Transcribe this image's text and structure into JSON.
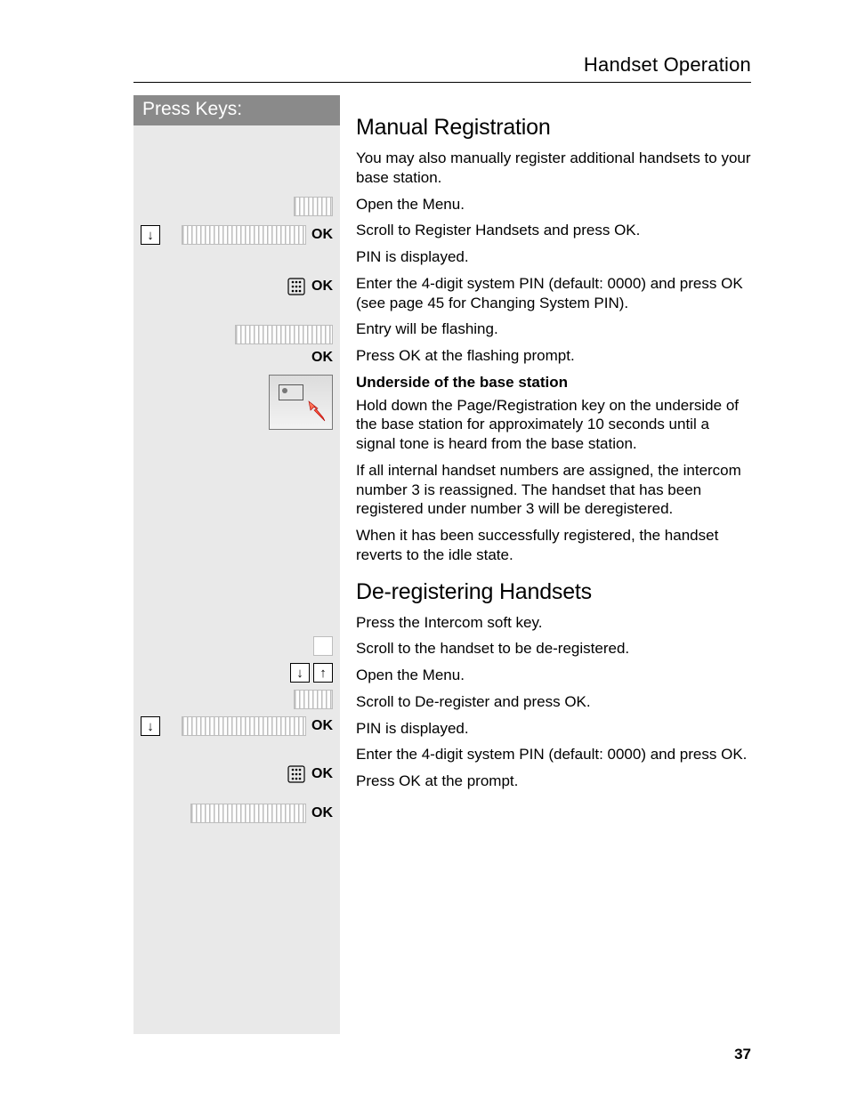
{
  "header": {
    "section_title": "Handset Operation"
  },
  "left": {
    "press_keys_label": "Press Keys:"
  },
  "ok_label": "OK",
  "content": {
    "h_manual": "Manual Registration",
    "p_intro": "You may also manually register additional handsets to your base station.",
    "p_open_menu": "Open the Menu.",
    "p_scroll_reg": "Scroll to Register Handsets and press OK.",
    "p_pin_disp": "PIN is displayed.",
    "p_enter_pin": "Enter the 4-digit system PIN (default: 0000) and press OK (see page 45 for Changing System PIN).",
    "p_entry_flash": "Entry will be flashing.",
    "p_press_ok_flash": "Press OK at the flashing prompt.",
    "p_underside_bold": "Underside of the base station",
    "p_hold_page": "Hold down the Page/Registration key on the underside of the base station for approximately 10 seconds until a signal tone is heard from the base station.",
    "p_reassign": "If all internal handset numbers are assigned, the intercom number 3 is reassigned. The handset that has been registered under number 3 will be deregistered.",
    "p_success": "When it has been successfully registered, the handset reverts to the idle state.",
    "h_dereg": "De-registering Handsets",
    "p_press_intercom": "Press the Intercom soft key.",
    "p_scroll_hs": "Scroll to the handset to be de-registered.",
    "p_open_menu2": "Open the Menu.",
    "p_scroll_dereg": "Scroll to De-register and press OK.",
    "p_pin_disp2": "PIN is displayed.",
    "p_enter_pin2": "Enter the 4-digit system PIN (default: 0000) and press OK.",
    "p_press_ok_prompt": "Press OK at the prompt."
  },
  "page_number": "37"
}
